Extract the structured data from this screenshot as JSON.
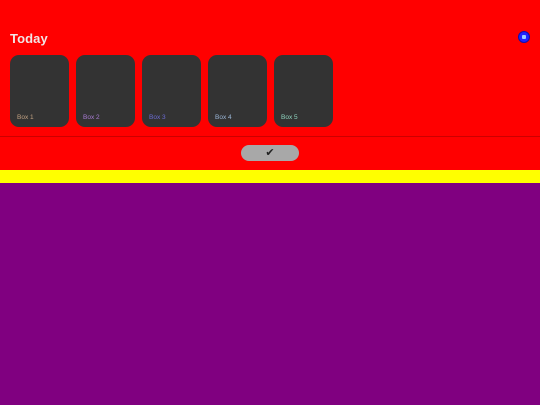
{
  "header": {
    "title": "Today",
    "status_icon": "status-dot-icon"
  },
  "boxes": [
    {
      "label": "Box 1",
      "label_color": "#c0a080"
    },
    {
      "label": "Box 2",
      "label_color": "#a77bd2"
    },
    {
      "label": "Box 3",
      "label_color": "#6b6bd4"
    },
    {
      "label": "Box 4",
      "label_color": "#9ab6d6"
    },
    {
      "label": "Box 5",
      "label_color": "#8fd6c0"
    }
  ],
  "confirm": {
    "icon": "checkmark-icon",
    "glyph": "✔"
  },
  "colors": {
    "panel_bg": "#ff0000",
    "title": "#f2e6e6",
    "divider": "#cc0000",
    "status_ring": "#2222ff",
    "status_inner": "#99ccff",
    "status_border": "#1010aa",
    "confirm_bg": "#a8a8a8",
    "confirm_fg": "#222222",
    "strip_bg": "#ffff00",
    "main_bg": "#800080"
  }
}
